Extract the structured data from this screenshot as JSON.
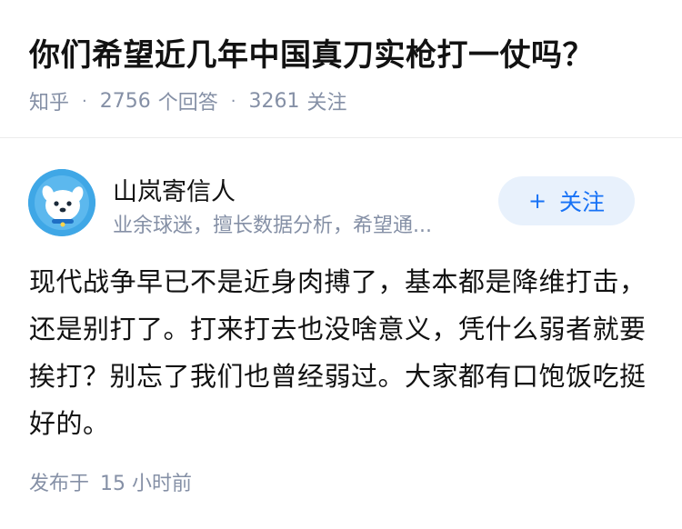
{
  "question": {
    "title": "你们希望近几年中国真刀实枪打一仗吗？",
    "source": "知乎",
    "answer_count": "2756",
    "answer_label": "个回答",
    "follow_count": "3261",
    "follow_label": "关注",
    "separator": "·"
  },
  "author": {
    "name": "山岚寄信人",
    "bio": "业余球迷，擅长数据分析，希望通...",
    "follow_plus": "+",
    "follow_label": "关注",
    "avatar_icon": "cartoon-dog-avatar"
  },
  "answer": {
    "text": "现代战争早已不是近身肉搏了，基本都是降维打击，还是别打了。打来打去也没啥意义，凭什么弱者就要挨打？别忘了我们也曾经弱过。大家都有口饱饭吃挺好的。",
    "published_label": "发布于",
    "published_time": "15 小时前"
  },
  "colors": {
    "title": "#121212",
    "meta": "#8590a6",
    "accent": "#1772f6",
    "follow_bg": "#e8f1fc",
    "avatar_bg": "#3fa7e6"
  }
}
